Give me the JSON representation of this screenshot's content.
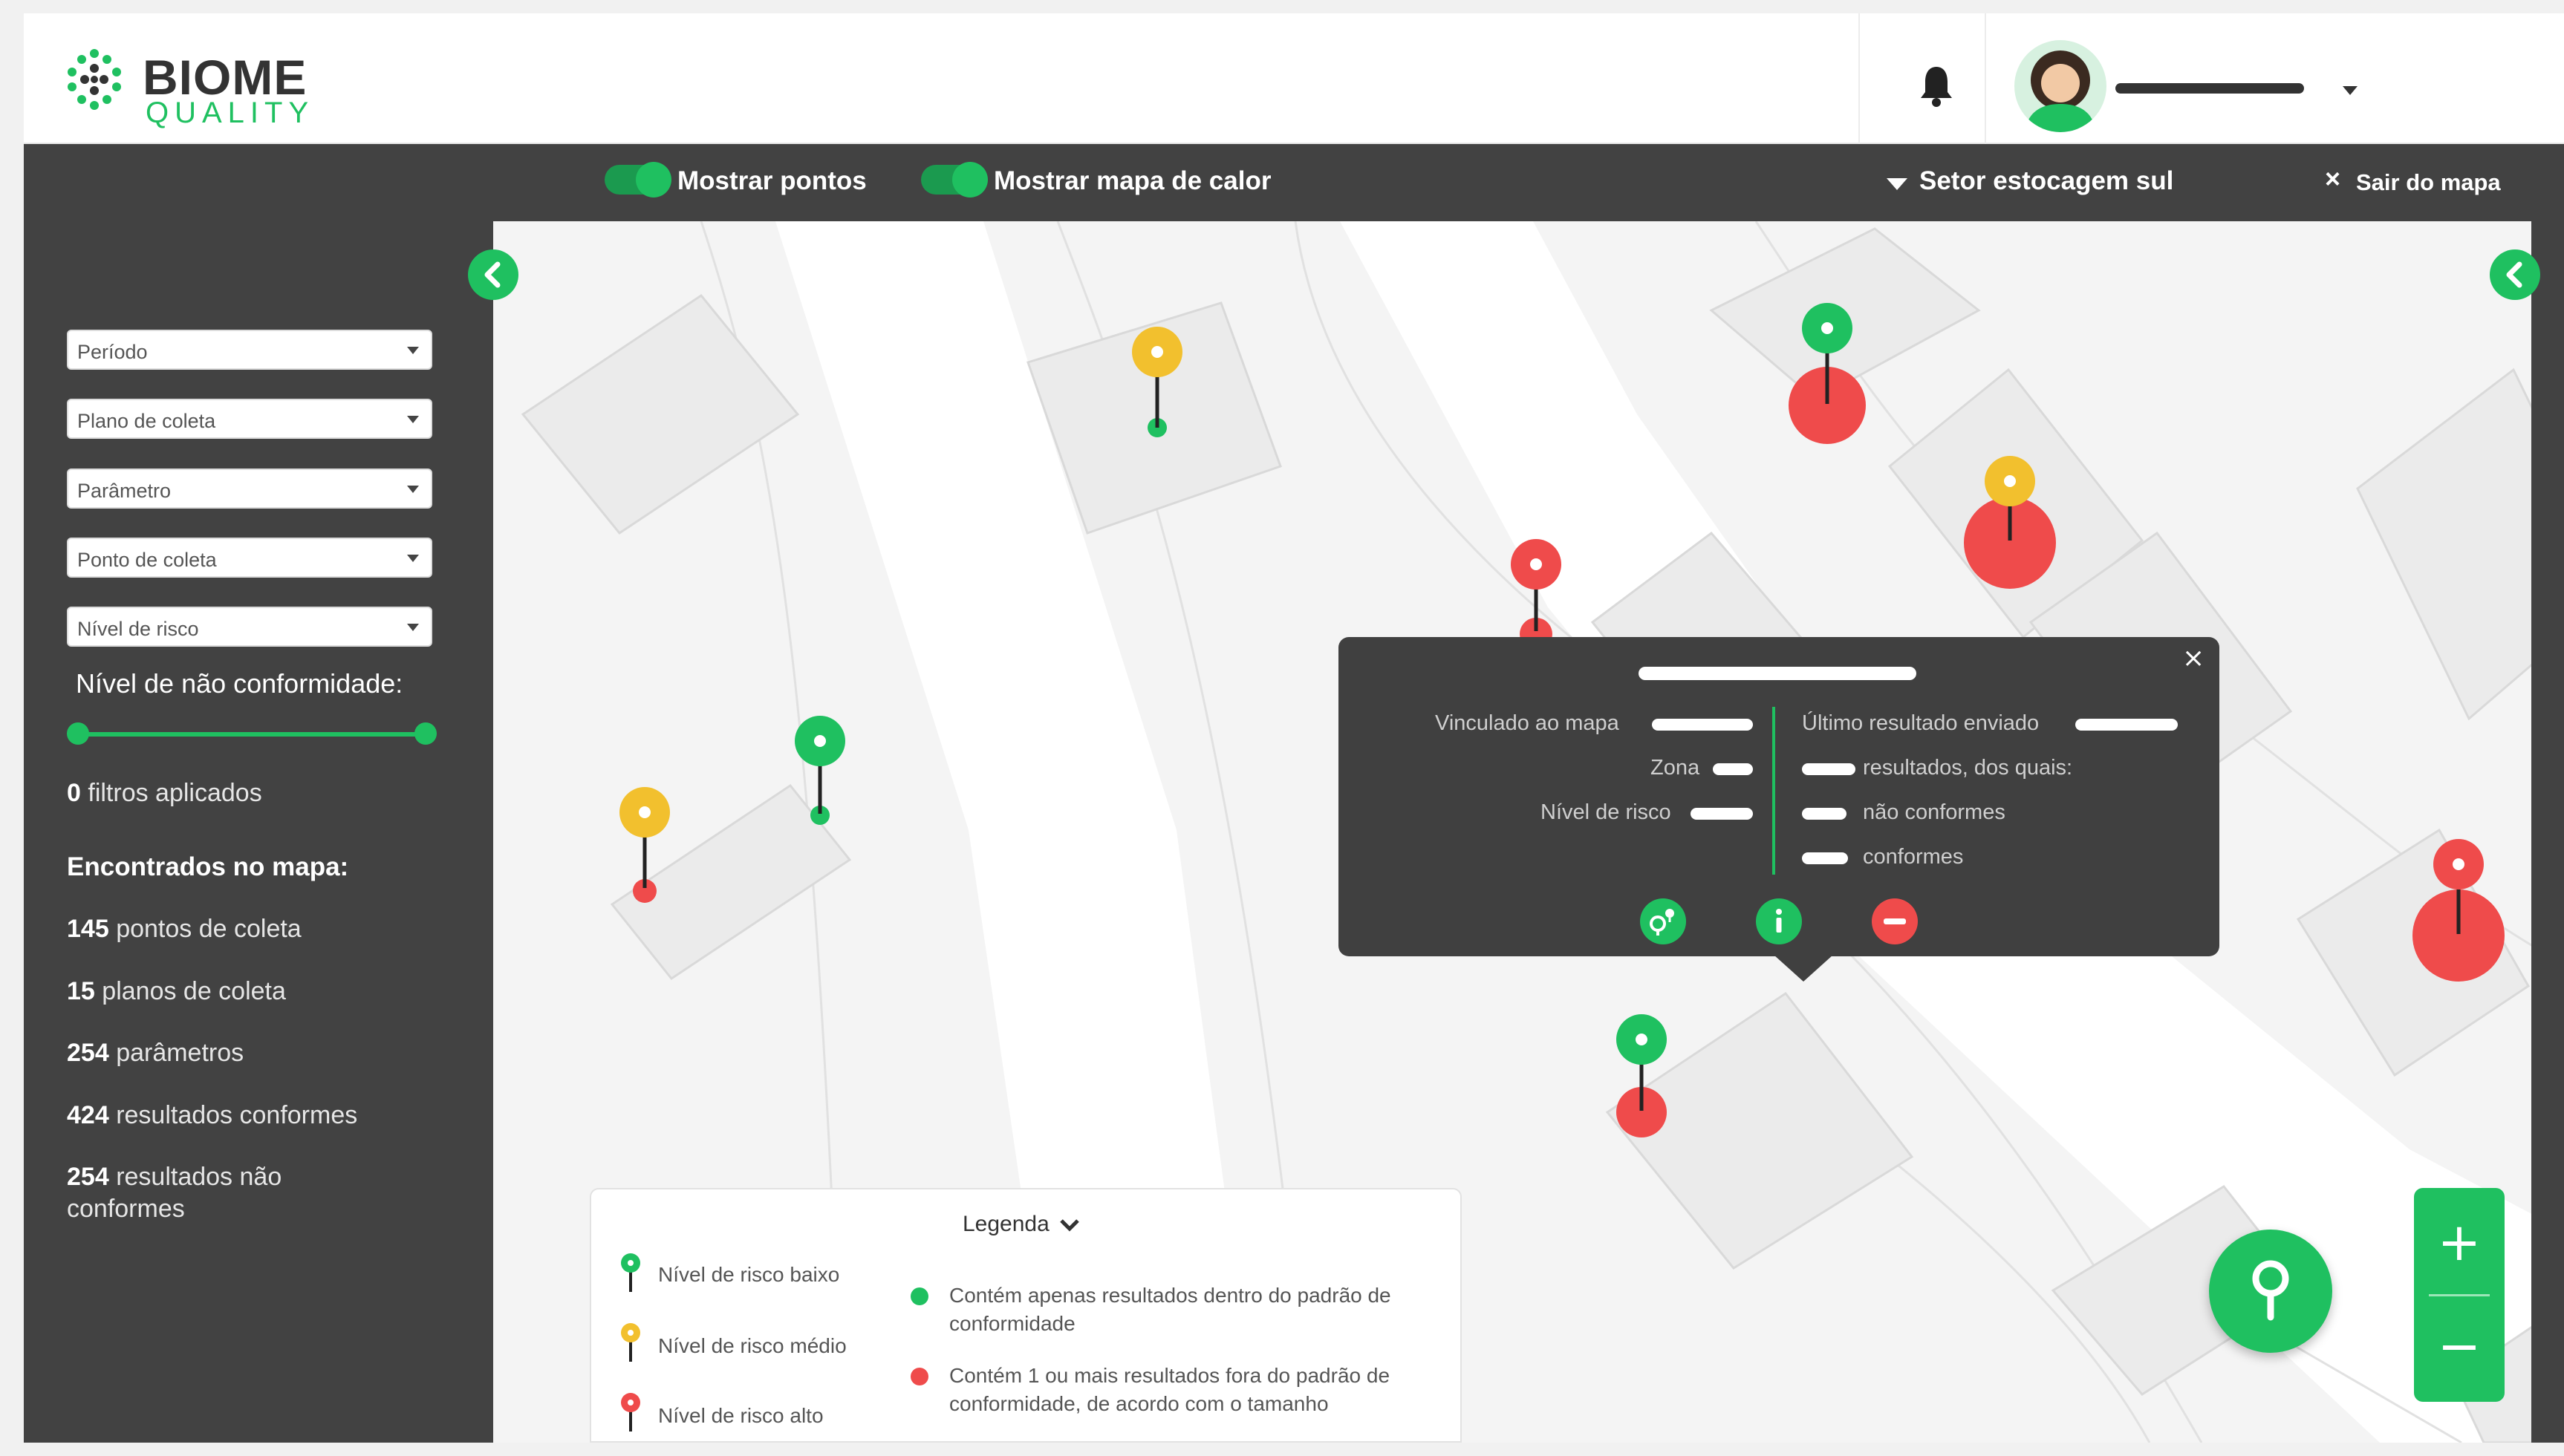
{
  "brand": {
    "name": "BIOME",
    "sub": "QUALITY"
  },
  "header": {
    "icons": [
      "bell-icon",
      "user-avatar",
      "chevron-down-icon"
    ]
  },
  "toolbar": {
    "show_points": "Mostrar pontos",
    "show_heatmap": "Mostrar mapa de calor",
    "sector": "Setor estocagem sul",
    "exit": "Sair do mapa",
    "exit_icon": "×"
  },
  "filters": [
    {
      "label": "Período"
    },
    {
      "label": "Plano de coleta"
    },
    {
      "label": "Parâmetro"
    },
    {
      "label": "Ponto de coleta"
    },
    {
      "label": "Nível de risco"
    }
  ],
  "sidebar": {
    "nonconformity_label": "Nível de não conformidade:",
    "filters_count": "0",
    "filters_text": "filtros aplicados",
    "found_heading": "Encontrados no mapa:",
    "stats": [
      {
        "value": "145",
        "label": "pontos de coleta"
      },
      {
        "value": "15",
        "label": "planos de coleta"
      },
      {
        "value": "254",
        "label": "parâmetros"
      },
      {
        "value": "424",
        "label": "resultados conformes"
      },
      {
        "value": "254",
        "label": "resultados não conformes"
      }
    ]
  },
  "popup": {
    "close": "×",
    "left_labels": [
      "Vinculado ao mapa",
      "Zona",
      "Nível de risco"
    ],
    "right_labels": [
      "Último resultado enviado",
      "resultados, dos quais:",
      "não conformes",
      "conformes"
    ],
    "buttons": [
      "link-point-icon",
      "info-icon",
      "remove-icon"
    ]
  },
  "legend": {
    "title": "Legenda",
    "risk_low": "Nível de risco baixo",
    "risk_mid": "Nível de risco médio",
    "risk_high": "Nível de risco alto",
    "only_conforming": "Contém apenas resultados dentro do padrão de conformidade",
    "nonconforming": "Contém 1 ou mais resultados fora do padrão de conformidade, de acordo com o tamanho"
  },
  "zoom": {
    "in": "+",
    "out": "−"
  },
  "colors": {
    "green": "#1fc060",
    "yellow": "#f2c02e",
    "red": "#ef4b4b",
    "dark": "#424242"
  }
}
